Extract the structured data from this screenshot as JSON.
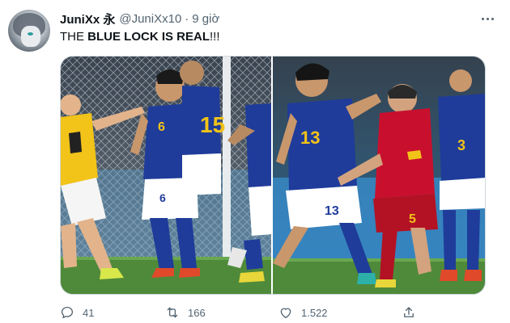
{
  "tweet": {
    "display_name": "JuniXx 永",
    "handle": "@JuniXx10",
    "separator": "·",
    "time": "9 giờ",
    "text_prefix": "THE ",
    "text_bold": "BLUE LOCK IS REAL",
    "text_suffix": "!!!"
  },
  "icons": {
    "more": "more-horizontal-icon",
    "reply": "reply-icon",
    "retweet": "retweet-icon",
    "like": "heart-icon",
    "share": "share-icon"
  },
  "actions": {
    "replies": "41",
    "retweets": "166",
    "likes": "1.522"
  },
  "photos": {
    "left": {
      "jersey_numbers": [
        "6",
        "15"
      ],
      "keeper_number": "1"
    },
    "right": {
      "jersey_numbers": [
        "13",
        "5",
        "3"
      ]
    }
  },
  "colors": {
    "text_primary": "#0f1419",
    "text_secondary": "#536471",
    "border": "#cfd9de",
    "japan_blue": "#1f3c9a",
    "spain_red": "#c8102e",
    "keeper_yellow": "#f2c318",
    "pitch_green": "#4f8a3a"
  }
}
